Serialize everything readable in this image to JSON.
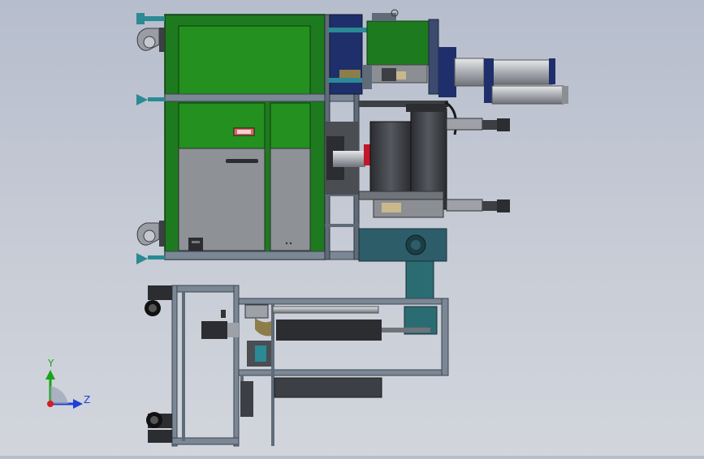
{
  "viewport": {
    "background_top": "#b6bdcc",
    "background_bottom": "#d2d5dc"
  },
  "axes_triad": {
    "y_label": "Y",
    "z_label": "Z",
    "y_color": "#1aa31a",
    "z_color": "#1f3fd6",
    "x_color": "#d21f1f"
  },
  "colors": {
    "cabinet_green": "#1e7a1e",
    "frame_blue_gray": "#5f6b78",
    "teal_base": "#2e5d6a",
    "steel_gray": "#8b8e93",
    "navy": "#1f2f6b",
    "dark_gray": "#3c3f44",
    "red_accent": "#c4162a"
  }
}
